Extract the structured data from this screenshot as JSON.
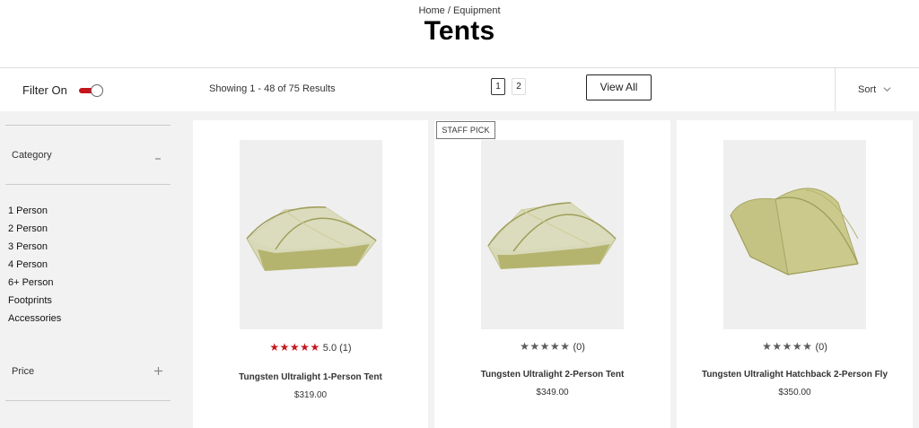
{
  "header": {
    "breadcrumb": {
      "home": "Home",
      "separator": " / ",
      "current": "Equipment"
    },
    "title": "Tents"
  },
  "toolbar": {
    "filter_label": "Filter On",
    "filter_on": true,
    "result_count": "Showing 1 - 48 of 75 Results",
    "pages": [
      "1",
      "2"
    ],
    "current_page": "1",
    "view_all_label": "View All",
    "sort_label": "Sort"
  },
  "sidebar": {
    "category_label": "Category",
    "category_items": [
      "1 Person",
      "2 Person",
      "3 Person",
      "4 Person",
      "6+ Person",
      "Footprints",
      "Accessories"
    ],
    "price_label": "Price"
  },
  "products": [
    {
      "name": "Tungsten Ultralight 1-Person Tent",
      "price": "$319.00",
      "rating": 5,
      "rating_text": "5.0",
      "review_count": "(1)",
      "badge": ""
    },
    {
      "name": "Tungsten Ultralight 2-Person Tent",
      "price": "$349.00",
      "rating": 0,
      "rating_text": "",
      "review_count": "(0)",
      "badge": "STAFF PICK"
    },
    {
      "name": "Tungsten Ultralight Hatchback 2-Person Fly",
      "price": "$350.00",
      "rating": 0,
      "rating_text": "",
      "review_count": "(0)",
      "badge": ""
    }
  ],
  "colors": {
    "accent_red": "#c4161c",
    "tent_green": "#c8c78a",
    "background": "#f2f2f2"
  },
  "icons": {
    "toggle": "toggle-switch-icon",
    "sort": "chevron-down-icon",
    "collapse": "minus-icon",
    "expand": "plus-icon",
    "star": "star-icon"
  }
}
